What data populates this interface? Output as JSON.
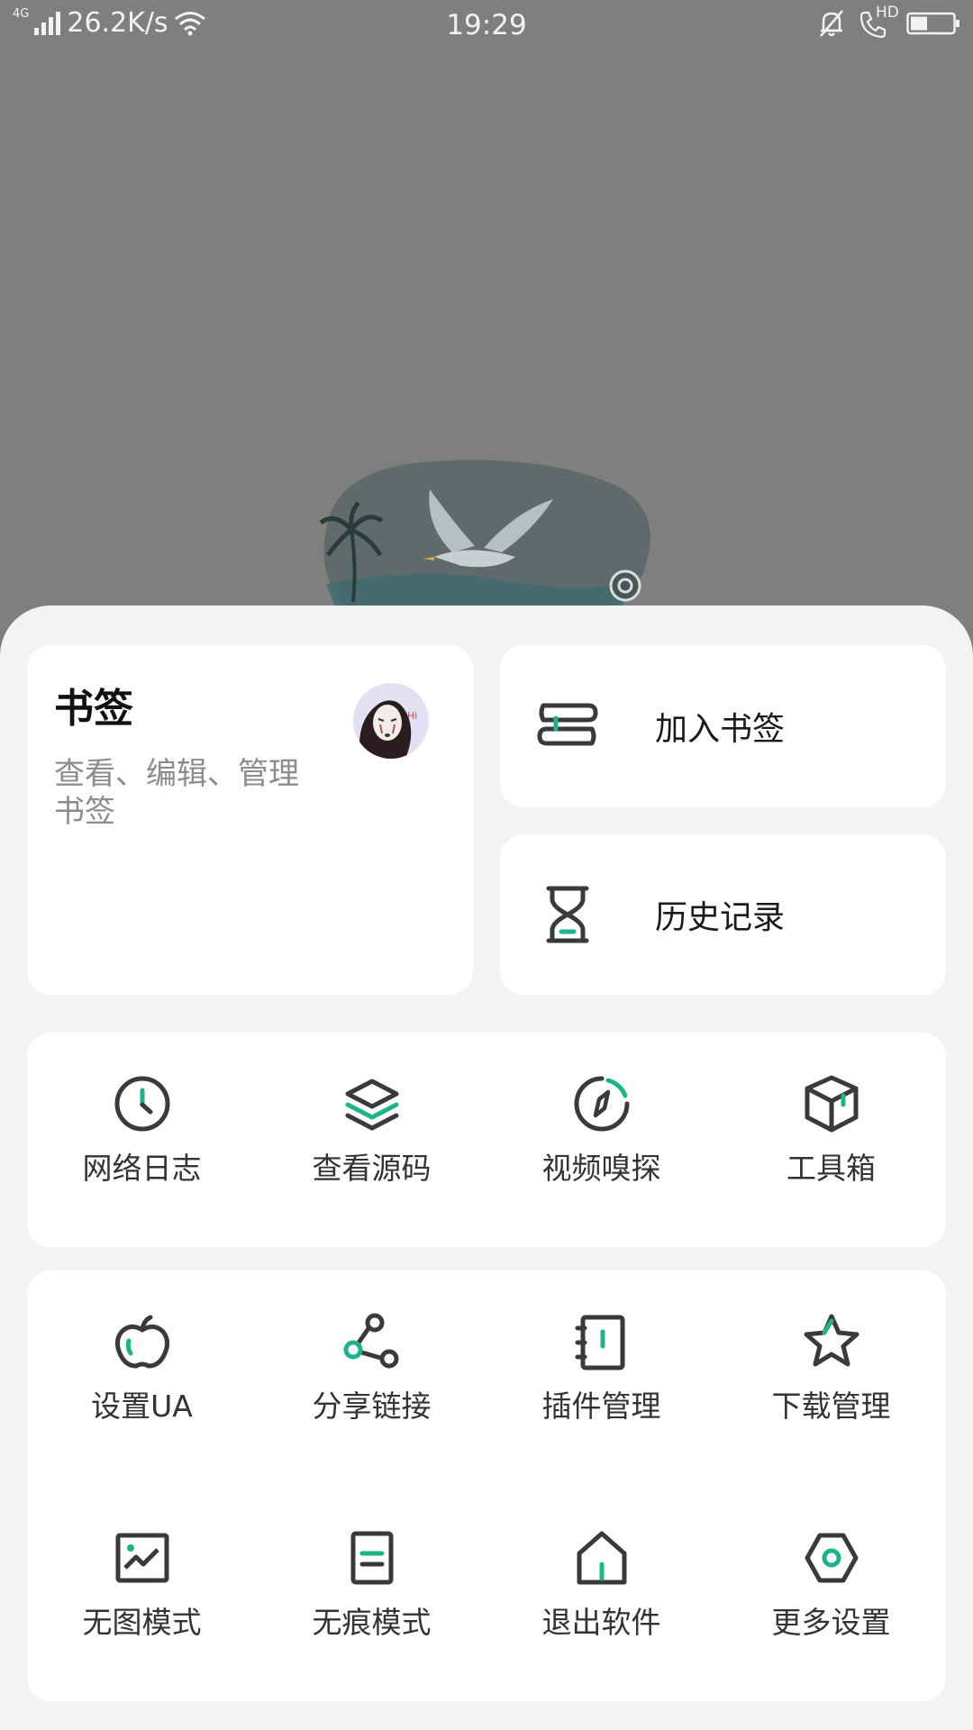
{
  "status_bar": {
    "network_type": "4G",
    "speed": "26.2K/s",
    "time": "19:29",
    "hd_label": "HD",
    "icons": [
      "signal-icon",
      "wifi-icon",
      "bell-muted-icon",
      "hd-call-icon",
      "battery-icon"
    ]
  },
  "bookmarks": {
    "title": "书签",
    "description": "查看、编辑、管理书签",
    "avatar": "avatar"
  },
  "quick_actions": [
    {
      "label": "加入书签",
      "icon": "add-bookmark-icon"
    },
    {
      "label": "历史记录",
      "icon": "hourglass-icon"
    }
  ],
  "tools": [
    {
      "label": "网络日志",
      "icon": "clock-icon"
    },
    {
      "label": "查看源码",
      "icon": "layers-icon"
    },
    {
      "label": "视频嗅探",
      "icon": "compass-icon"
    },
    {
      "label": "工具箱",
      "icon": "box-icon"
    }
  ],
  "more": [
    {
      "label": "设置UA",
      "icon": "apple-icon"
    },
    {
      "label": "分享链接",
      "icon": "share-icon"
    },
    {
      "label": "插件管理",
      "icon": "plugin-book-icon"
    },
    {
      "label": "下载管理",
      "icon": "star-icon"
    },
    {
      "label": "无图模式",
      "icon": "image-icon"
    },
    {
      "label": "无痕模式",
      "icon": "document-icon"
    },
    {
      "label": "退出软件",
      "icon": "home-exit-icon"
    },
    {
      "label": "更多设置",
      "icon": "hexagon-settings-icon"
    }
  ],
  "colors": {
    "accent": "#1fb38a",
    "icon_stroke": "#3a3a3a",
    "backdrop": "#7f7f7f",
    "sheet": "#f3f3f3",
    "card": "#ffffff"
  }
}
